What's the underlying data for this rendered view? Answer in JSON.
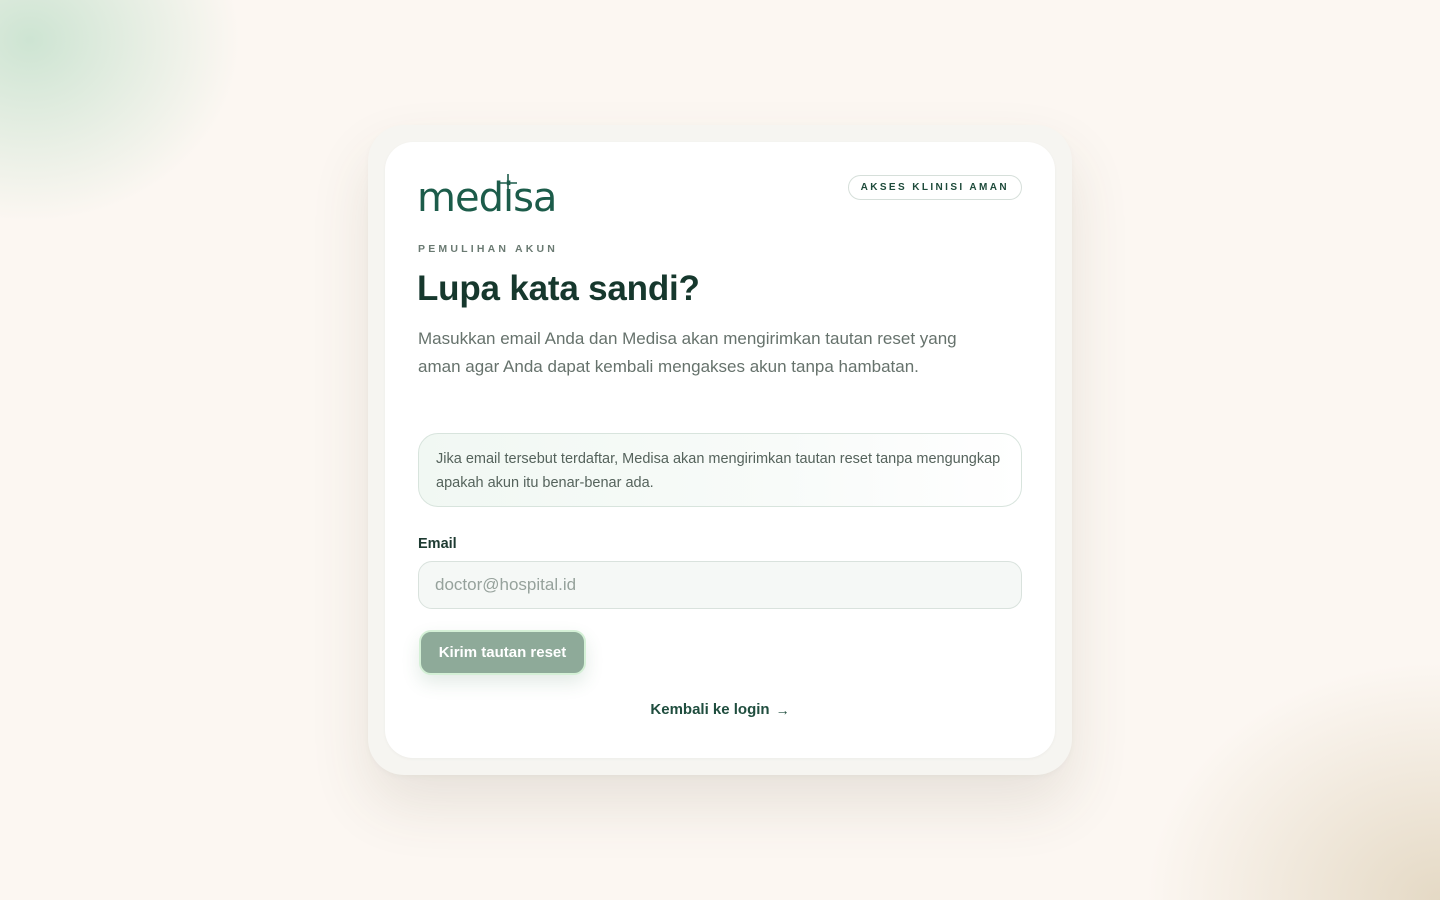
{
  "brand": {
    "logo_text": "medisa",
    "badge": "AKSES KLINISI AMAN"
  },
  "header": {
    "eyebrow": "PEMULIHAN AKUN",
    "title": "Lupa kata sandi?",
    "description": "Masukkan email Anda dan Medisa akan mengirimkan tautan reset yang aman agar Anda dapat kembali mengakses akun tanpa hambatan."
  },
  "notice": {
    "text": "Jika email tersebut terdaftar, Medisa akan mengirimkan tautan reset tanpa mengungkap apakah akun itu benar-benar ada."
  },
  "form": {
    "email_label": "Email",
    "email_value": "",
    "email_placeholder": "doctor@hospital.id",
    "submit_label": "Kirim tautan reset"
  },
  "footer": {
    "back_label": "Kembali ke login",
    "back_icon": "arrow-right-icon"
  },
  "colors": {
    "brand_green": "#1c5c4a",
    "button": "#8eaa99",
    "title": "#16382d"
  }
}
